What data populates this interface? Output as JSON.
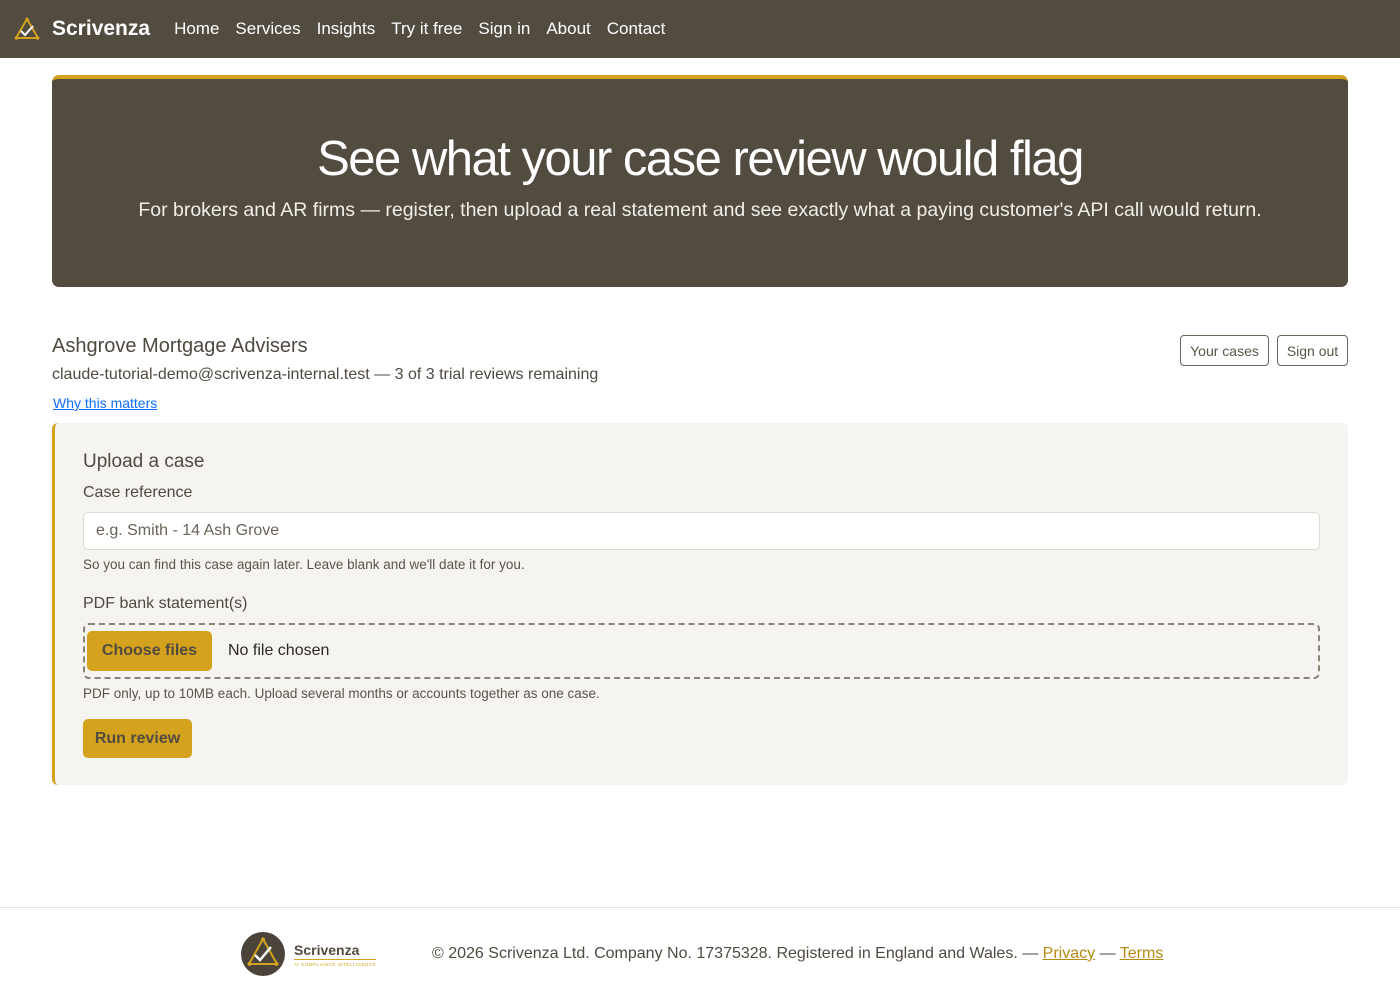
{
  "nav": {
    "brand": "Scrivenza",
    "items": [
      "Home",
      "Services",
      "Insights",
      "Try it free",
      "Sign in",
      "About",
      "Contact"
    ]
  },
  "hero": {
    "title": "See what your case review would flag",
    "subtitle": "For brokers and AR firms — register, then upload a real statement and see exactly what a paying customer's API call would return."
  },
  "account": {
    "name": "Ashgrove Mortgage Advisers",
    "info": "claude-tutorial-demo@scrivenza-internal.test — 3 of 3 trial reviews remaining",
    "why_link": "Why this matters",
    "cases_button": "Your cases",
    "signout_button": "Sign out"
  },
  "upload": {
    "title": "Upload a case",
    "ref_label": "Case reference",
    "ref_placeholder": "e.g. Smith - 14 Ash Grove",
    "ref_help": "So you can find this case again later. Leave blank and we'll date it for you.",
    "pdf_label": "PDF bank statement(s)",
    "choose_button": "Choose files",
    "no_file": "No file chosen",
    "pdf_help": "PDF only, up to 10MB each. Upload several months or accounts together as one case.",
    "run_button": "Run review"
  },
  "footer": {
    "logo_name": "Scrivenza",
    "logo_tagline": "AI COMPLIANCE INTELLIGENCE",
    "copyright": "© 2026 Scrivenza Ltd. Company No. 17375328. Registered in England and Wales. — ",
    "privacy": "Privacy",
    "separator": " — ",
    "terms": "Terms"
  },
  "colors": {
    "nav_bg": "#524b40",
    "accent": "#d4a21c",
    "link": "#0d6efd"
  }
}
